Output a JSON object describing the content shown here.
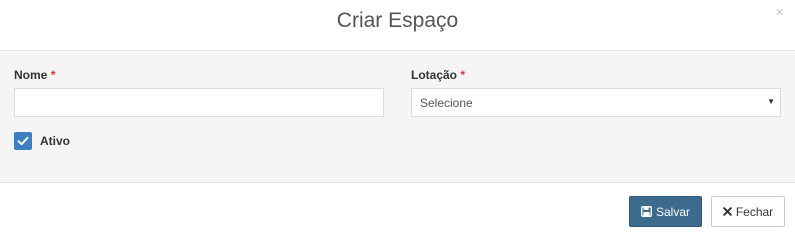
{
  "modal": {
    "title": "Criar Espaço",
    "close_glyph": "×"
  },
  "form": {
    "nome": {
      "label": "Nome",
      "required_mark": "*",
      "value": "",
      "placeholder": ""
    },
    "lotacao": {
      "label": "Lotação",
      "required_mark": "*",
      "selected": "Selecione",
      "caret_glyph": "▼"
    },
    "ativo": {
      "label": "Ativo",
      "checked": true
    }
  },
  "footer": {
    "save_label": "Salvar",
    "save_icon": "save-icon",
    "close_label": "Fechar",
    "close_icon": "times-icon"
  },
  "colors": {
    "primary_button": "#3c6b8e",
    "checkbox": "#3d7fc1",
    "required": "#e02f2f",
    "body_background": "#f5f5f5"
  }
}
